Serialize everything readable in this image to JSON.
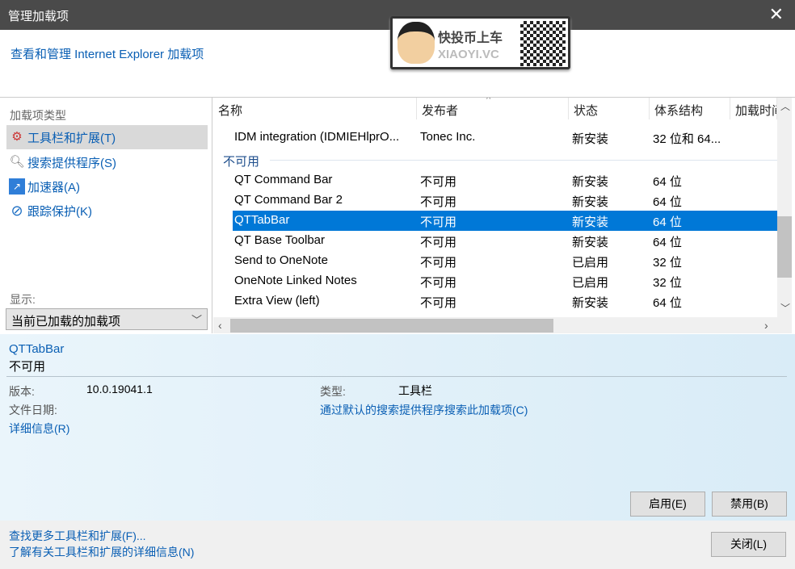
{
  "window": {
    "title": "管理加载项",
    "close_icon": "close-icon"
  },
  "header": {
    "link": "查看和管理 Internet Explorer 加载项"
  },
  "watermark": {
    "line1": "快投币上车",
    "line2": "XIAOYI.VC"
  },
  "left": {
    "heading": "加载项类型",
    "categories": [
      {
        "label": "工具栏和扩展(T)",
        "icon": "gear-blocked-icon",
        "selected": true
      },
      {
        "label": "搜索提供程序(S)",
        "icon": "search-icon"
      },
      {
        "label": "加速器(A)",
        "icon": "accelerator-icon"
      },
      {
        "label": "跟踪保护(K)",
        "icon": "block-icon"
      }
    ],
    "show_label": "显示:",
    "show_value": "当前已加载的加载项"
  },
  "list": {
    "columns": [
      "名称",
      "发布者",
      "状态",
      "体系结构",
      "加载时间"
    ],
    "top_row": {
      "name": "IDM integration (IDMIEHlprO...",
      "publisher": "Tonec Inc.",
      "status": "新安装",
      "arch": "32 位和 64..."
    },
    "group": "不可用",
    "rows": [
      {
        "name": "QT Command Bar",
        "publisher": "不可用",
        "status": "新安装",
        "arch": "64 位"
      },
      {
        "name": "QT Command Bar 2",
        "publisher": "不可用",
        "status": "新安装",
        "arch": "64 位"
      },
      {
        "name": "QTTabBar",
        "publisher": "不可用",
        "status": "新安装",
        "arch": "64 位",
        "selected": true
      },
      {
        "name": "QT Base Toolbar",
        "publisher": "不可用",
        "status": "新安装",
        "arch": "64 位"
      },
      {
        "name": "Send to OneNote",
        "publisher": "不可用",
        "status": "已启用",
        "arch": "32 位"
      },
      {
        "name": "OneNote Linked Notes",
        "publisher": "不可用",
        "status": "已启用",
        "arch": "32 位"
      },
      {
        "name": "Extra View (left)",
        "publisher": "不可用",
        "status": "新安装",
        "arch": "64 位"
      }
    ]
  },
  "details": {
    "name": "QTTabBar",
    "status": "不可用",
    "version_label": "版本:",
    "version": "10.0.19041.1",
    "date_label": "文件日期:",
    "more_info": "详细信息(R)",
    "type_label": "类型:",
    "type": "工具栏",
    "search_link": "通过默认的搜索提供程序搜索此加载项(C)",
    "enable": "启用(E)",
    "disable": "禁用(B)"
  },
  "footer": {
    "find_more": "查找更多工具栏和扩展(F)...",
    "learn_more": "了解有关工具栏和扩展的详细信息(N)",
    "close": "关闭(L)"
  }
}
